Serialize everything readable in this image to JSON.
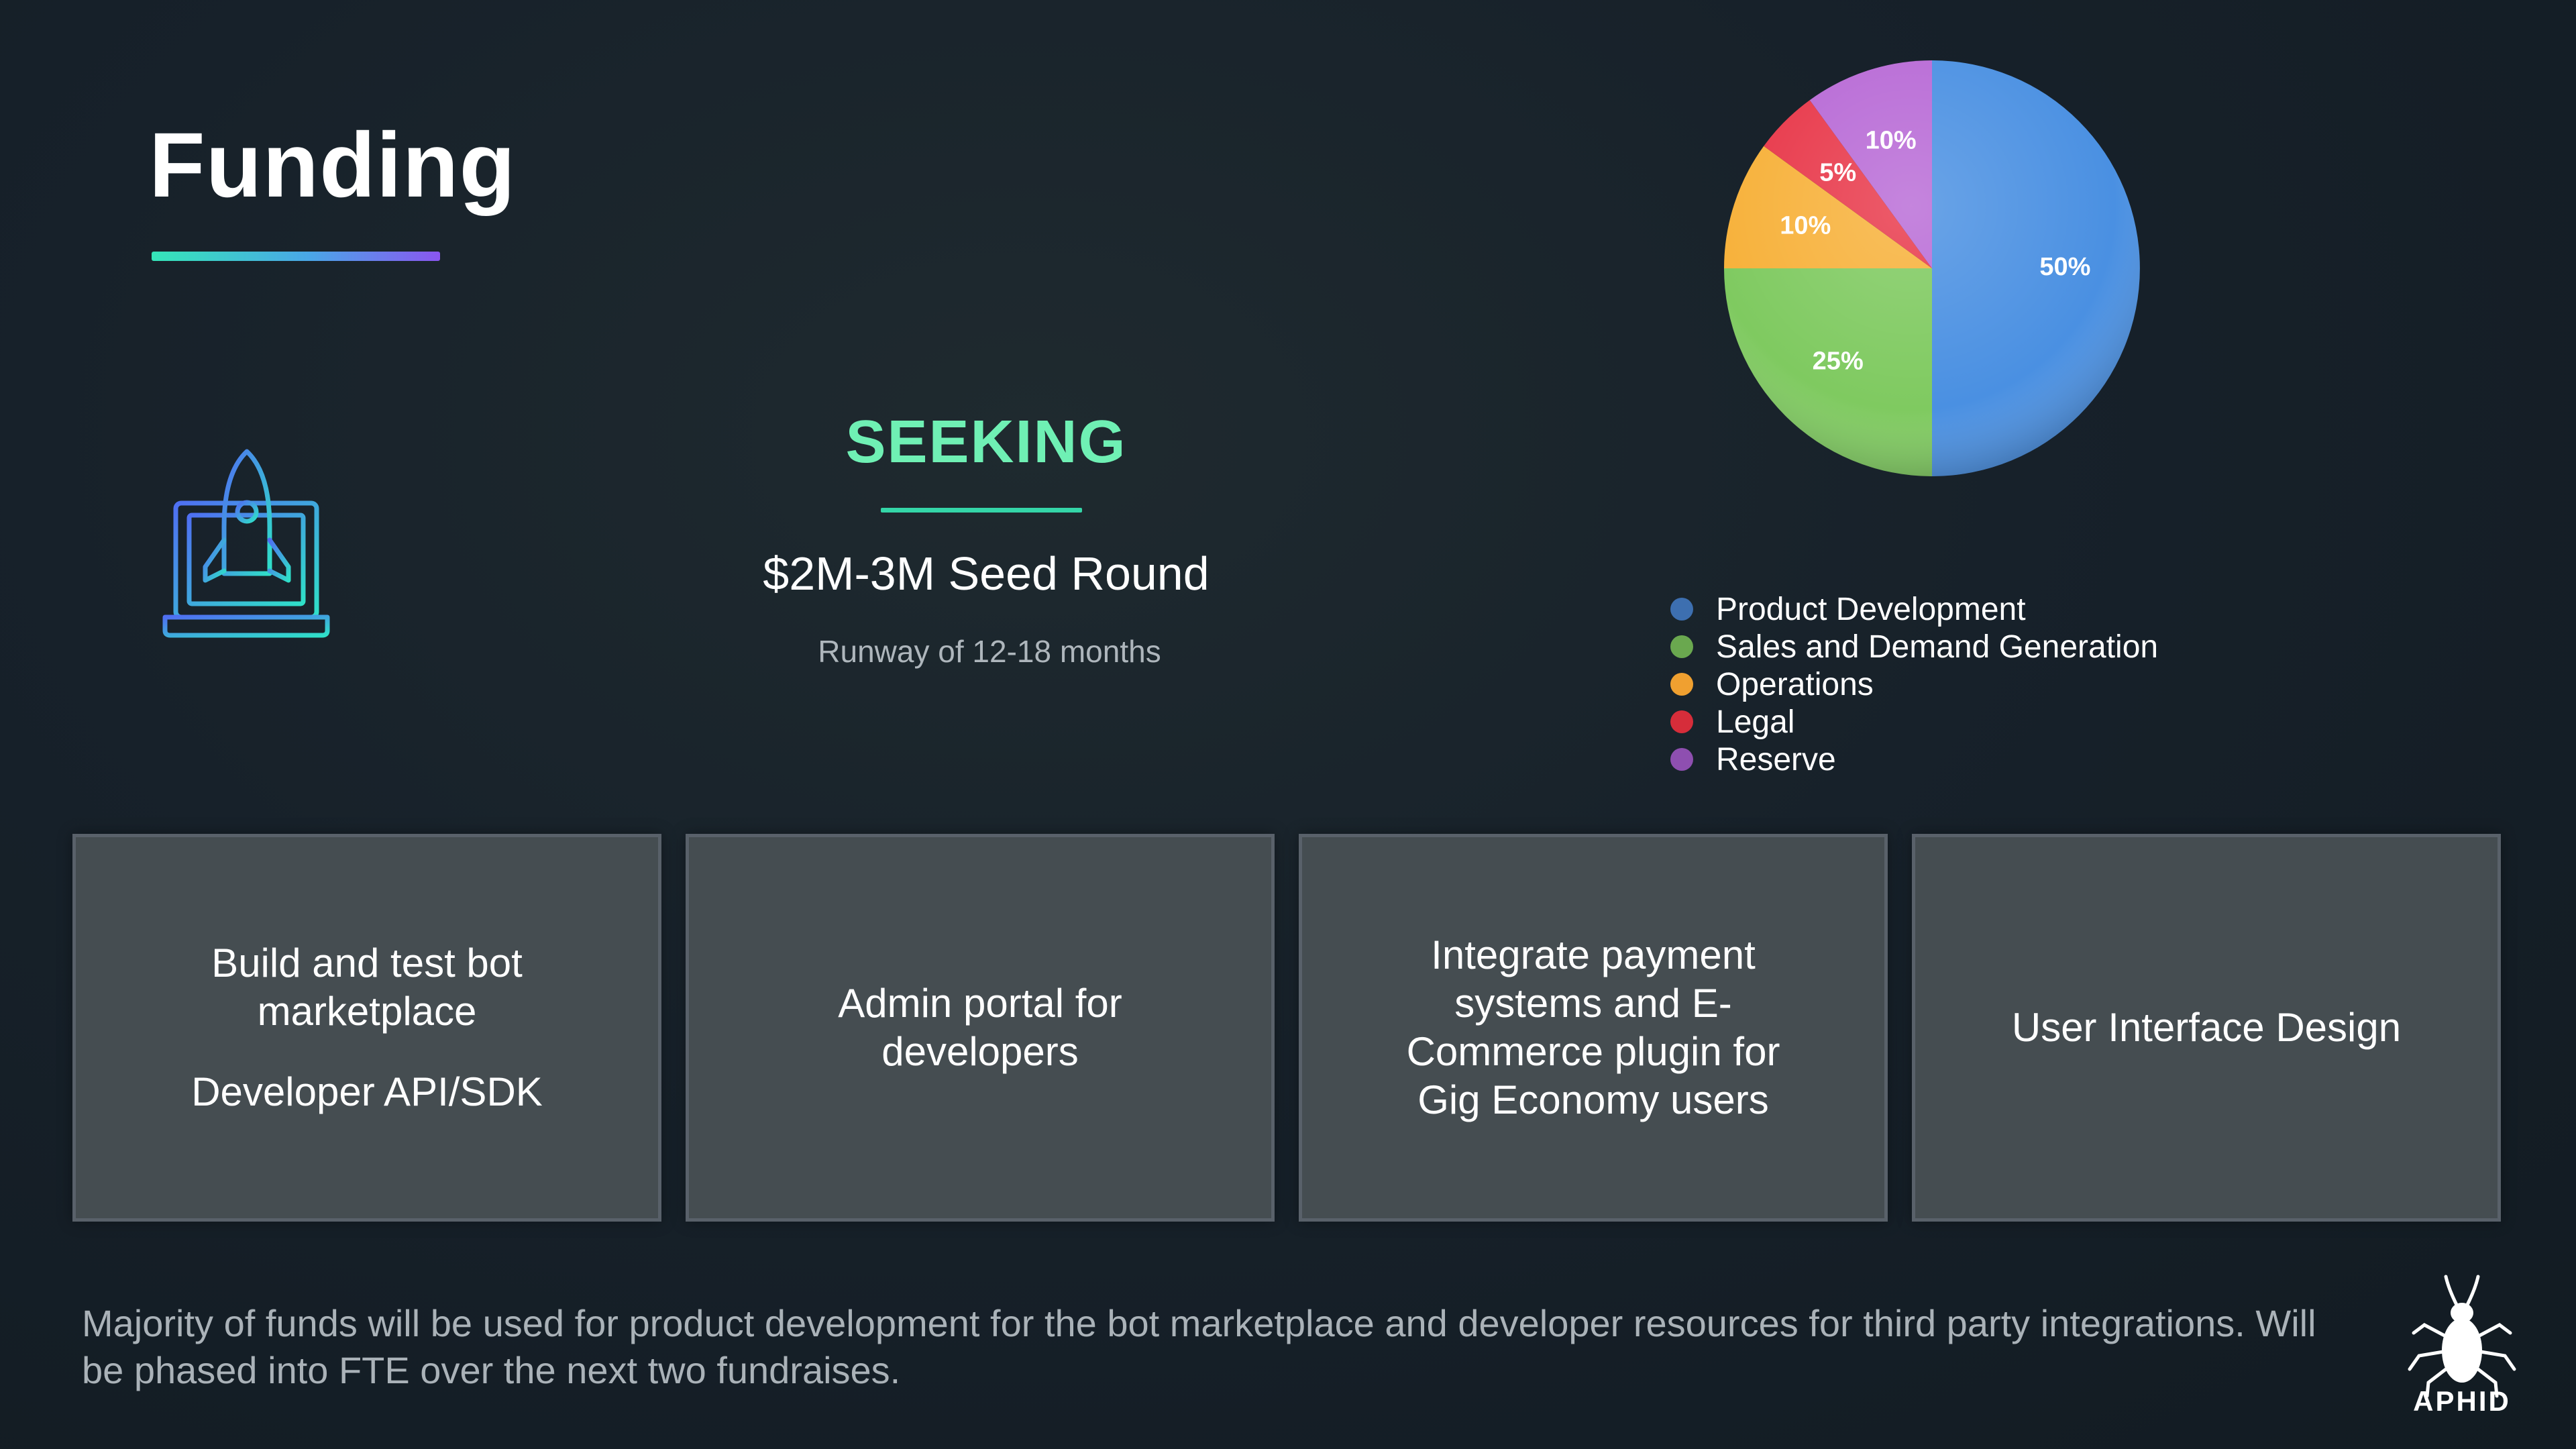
{
  "slide": {
    "title": "Funding"
  },
  "seeking": {
    "title": "SEEKING",
    "amount": "$2M-3M Seed Round",
    "runway": "Runway of 12-18 months"
  },
  "chart_data": {
    "type": "pie",
    "categories": [
      "Product Development",
      "Sales and Demand Generation",
      "Operations",
      "Legal",
      "Reserve"
    ],
    "values": [
      50,
      25,
      10,
      5,
      10
    ],
    "labels": [
      "50%",
      "25%",
      "10%",
      "5%",
      "10%"
    ],
    "colors": [
      "#4a90e2",
      "#7fca60",
      "#f7b13a",
      "#e8384a",
      "#b86ad6"
    ],
    "legend_colors": [
      "#3d6fb0",
      "#6aa84f",
      "#f0a030",
      "#d62d3a",
      "#8e4fb0"
    ],
    "legend": "bottom-left"
  },
  "cards": [
    {
      "text": "Build and test bot marketplace",
      "subtext": "Developer API/SDK"
    },
    {
      "text": "Admin portal for developers"
    },
    {
      "text": "Integrate payment systems and E-Commerce plugin for Gig Economy users"
    },
    {
      "text": "User Interface Design"
    }
  ],
  "footer": {
    "note": "Majority of funds will be used for product development for the bot marketplace and developer resources for third party integrations. Will be phased into FTE over the next two fundraises."
  },
  "logo": {
    "text": "APHID",
    "icon": "aphid-bug-icon"
  },
  "icons": {
    "rocket": "rocket-laptop-icon"
  },
  "colors": {
    "accent_green": "#6ff0b4",
    "accent_gradient_start": "#35e6b8",
    "accent_gradient_end": "#8a56f0",
    "card_bg": "#454d51"
  }
}
